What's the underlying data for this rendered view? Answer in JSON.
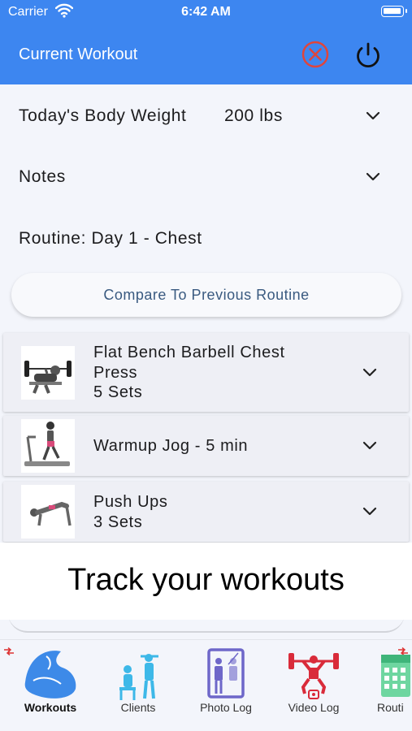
{
  "status_bar": {
    "carrier": "Carrier",
    "time": "6:42 AM"
  },
  "header": {
    "title": "Current Workout",
    "cancel_icon": "cancel-circle-icon",
    "power_icon": "power-icon",
    "color": "#3d86f0"
  },
  "body_weight": {
    "label": "Today's Body Weight",
    "value": "200 lbs"
  },
  "notes": {
    "label": "Notes"
  },
  "routine": {
    "label": "Routine: Day 1 - Chest"
  },
  "compare_button": {
    "label": "Compare To Previous Routine"
  },
  "exercises": [
    {
      "name_line1": "Flat Bench Barbell Chest",
      "name_line2": "Press",
      "sets": "5 Sets",
      "icon": "bench-press-image"
    },
    {
      "name": "Warmup Jog - 5 min",
      "icon": "treadmill-image"
    },
    {
      "name": "Push Ups",
      "sets": "3 Sets",
      "icon": "push-up-image"
    }
  ],
  "banner": {
    "text": "Track your workouts"
  },
  "tabs": [
    {
      "label": "Workouts",
      "icon": "flexed-bicep-icon",
      "active": true
    },
    {
      "label": "Clients",
      "icon": "trainer-clients-icon",
      "active": false
    },
    {
      "label": "Photo Log",
      "icon": "mirror-photo-icon",
      "active": false
    },
    {
      "label": "Video Log",
      "icon": "weightlifter-video-icon",
      "active": false
    },
    {
      "label": "Routi",
      "icon": "calendar-icon",
      "active": false
    }
  ]
}
